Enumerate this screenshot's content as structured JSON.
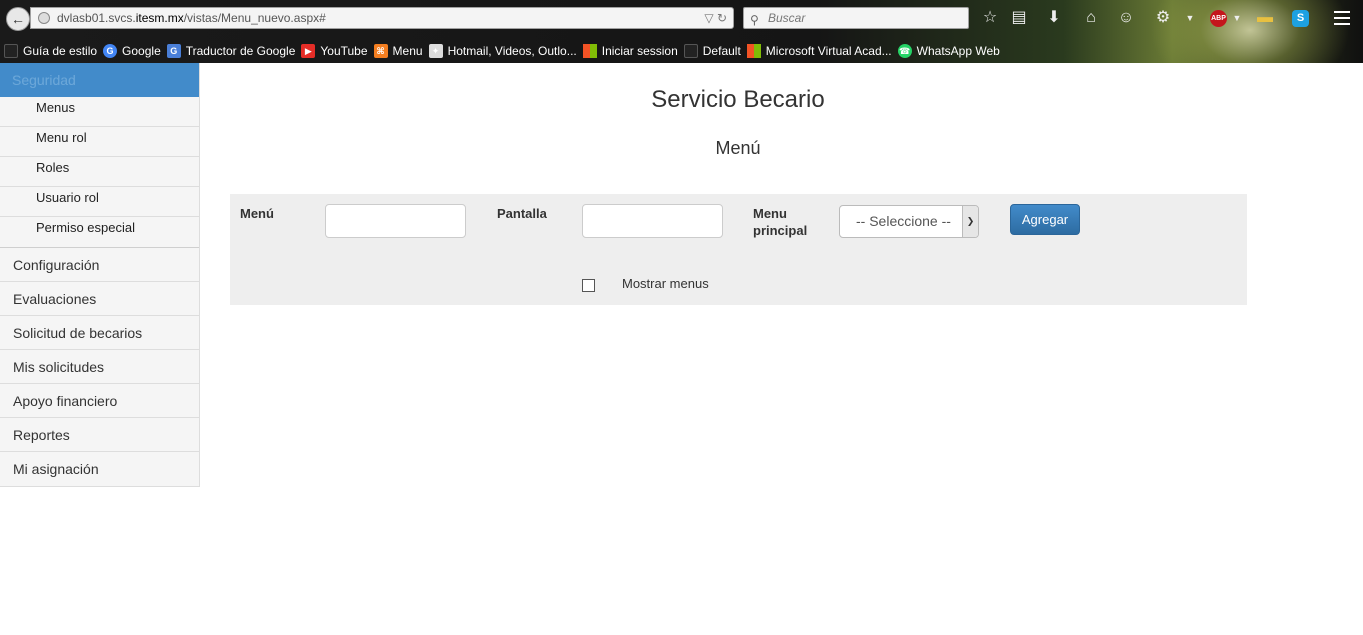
{
  "browser": {
    "url_prefix": "dvlasb01.svcs.",
    "url_host": "itesm.mx",
    "url_path": "/vistas/Menu_nuevo.aspx#",
    "search_placeholder": "Buscar",
    "addon_abp": "ABP",
    "addon_skype": "S",
    "bookmarks": [
      {
        "label": "Guía de estilo",
        "icon": "page-icon",
        "color": "#222222"
      },
      {
        "label": "Google",
        "icon": "google-icon",
        "color": "#4285f4"
      },
      {
        "label": "Traductor de Google",
        "icon": "translate-icon",
        "color": "#4a7fd8"
      },
      {
        "label": "YouTube",
        "icon": "youtube-icon",
        "color": "#e52d27"
      },
      {
        "label": "Menu",
        "icon": "xampp-icon",
        "color": "#f47e20"
      },
      {
        "label": "Hotmail, Videos, Outlo...",
        "icon": "msn-icon",
        "color": "#dddddd"
      },
      {
        "label": "Iniciar session",
        "icon": "windows-icon",
        "color": "#f35325"
      },
      {
        "label": "Default",
        "icon": "page-icon",
        "color": "#222222"
      },
      {
        "label": "Microsoft Virtual Acad...",
        "icon": "windows-icon",
        "color": "#f35325"
      },
      {
        "label": "WhatsApp Web",
        "icon": "whatsapp-icon",
        "color": "#25d366"
      }
    ]
  },
  "sidebar": {
    "active": "Seguridad",
    "sub_items": [
      "Menus",
      "Menu rol",
      "Roles",
      "Usuario rol",
      "Permiso especial"
    ],
    "items": [
      "Configuración",
      "Evaluaciones",
      "Solicitud de becarios",
      "Mis solicitudes",
      "Apoyo financiero",
      "Reportes",
      "Mi asignación"
    ]
  },
  "page": {
    "title": "Servicio Becario",
    "subtitle": "Menú"
  },
  "form": {
    "menu_label": "Menú",
    "menu_value": "",
    "pantalla_label": "Pantalla",
    "pantalla_value": "",
    "principal_label": "Menu principal",
    "principal_selected": "-- Seleccione --",
    "add_button": "Agregar",
    "show_menus_label": "Mostrar menus",
    "show_menus_checked": false
  },
  "colors": {
    "accent": "#428bca",
    "panel": "#eeeeee",
    "sidebar_bg": "#f5f5f5"
  }
}
